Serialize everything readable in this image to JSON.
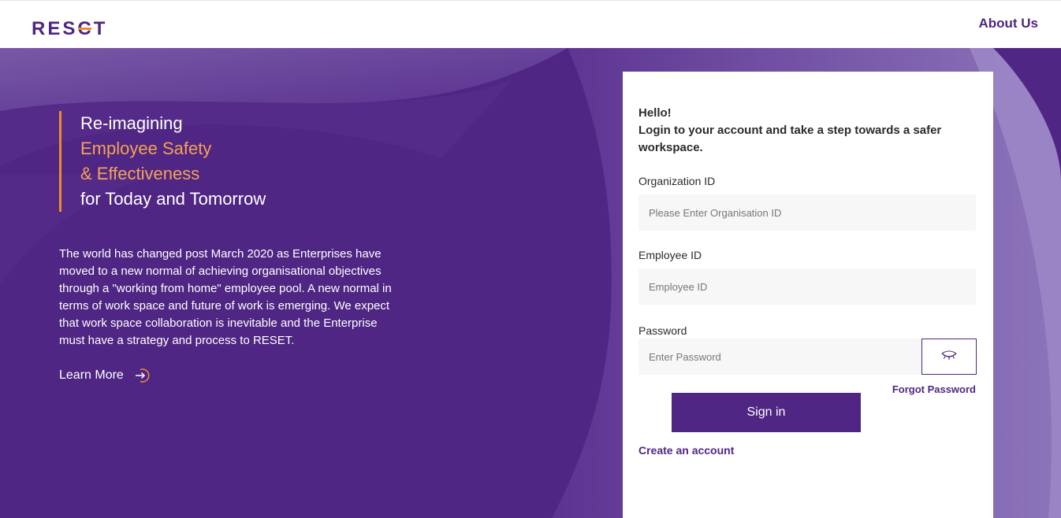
{
  "header": {
    "logo_text": [
      "RES",
      "C",
      "T"
    ],
    "about_label": "About Us"
  },
  "hero": {
    "tagline": {
      "line1": "Re-imagining",
      "line2": "Employee Safety",
      "line3": "& Effectiveness",
      "line4": "for Today and Tomorrow"
    },
    "intro": "The world has changed post March 2020 as Enterprises have moved to a new normal of achieving organisational objectives through a \"working from home\" employee pool. A new normal in terms of work space and future of work is emerging. We expect that work space collaboration is inevitable and the Enterprise must have a strategy and process to RESET.",
    "learn_more_label": "Learn More",
    "learn_more_icon": "arrow-in-circle-icon"
  },
  "login": {
    "greeting_line1": "Hello!",
    "greeting_line2": "Login to your account and take a step towards a safer workspace.",
    "org_label": "Organization ID",
    "org_placeholder": "Please Enter Organisation ID",
    "emp_label": "Employee ID",
    "emp_placeholder": "Employee ID",
    "pw_label": "Password",
    "pw_placeholder": "Enter Password",
    "eye_icon": "closed-eye-icon",
    "forgot_label": "Forgot Password",
    "signin_label": "Sign in",
    "create_label": "Create an account"
  },
  "colors": {
    "brand_purple": "#4f2683",
    "accent_orange": "#f08a32",
    "light_purple": "#8a6bb5"
  }
}
